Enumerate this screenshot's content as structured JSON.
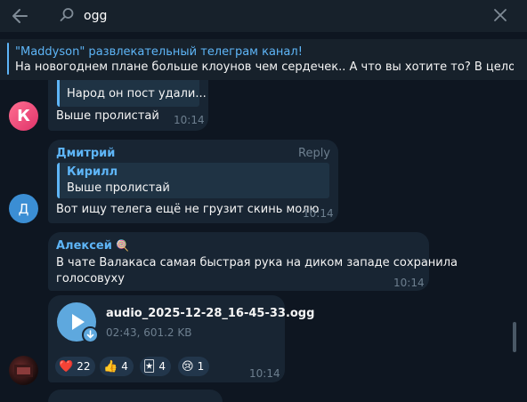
{
  "search": {
    "value": "ogg"
  },
  "pinned": {
    "title": "\"Maddyson\" развлекательный телеграм канал!",
    "text": "На новогоднем плане больше клоунов чем сердечек.. А что вы хотите то? В целом то, ч..."
  },
  "messages": [
    {
      "reply_text": "Народ он пост удали...",
      "text": "Выше пролистай",
      "time": "10:14",
      "avatar_letter": "К",
      "avatar_color": "#e6466f"
    },
    {
      "sender": "Дмитрий",
      "reply_label": "Reply",
      "reply_name": "Кирилл",
      "reply_text": "Выше пролистай",
      "text": "Вот ищу телега ещё не грузит скинь молю",
      "time": "10:14",
      "avatar_letter": "Д",
      "avatar_color": "#3b8ed4"
    },
    {
      "sender": "Алексей",
      "sender_emoji": "🍭",
      "text_line1": "В чате Валакаса самая быстрая рука на диком западе сохранила",
      "text_line2": "голосовуху",
      "time": "10:14"
    },
    {
      "file_name": "audio_2025-12-28_16-45-33.ogg",
      "file_meta": "02:43, 601.2 KB",
      "time": "10:14",
      "reactions": [
        {
          "emoji": "❤️",
          "count": "22"
        },
        {
          "emoji": "👍",
          "count": "4"
        },
        {
          "emoji": "🃏",
          "count": "4"
        },
        {
          "emoji": "😢",
          "count": "1"
        }
      ]
    }
  ],
  "colors": {
    "background": "#0e1621",
    "bubble": "#182533",
    "accent": "#5eb5f7",
    "muted": "#6d7f8f"
  }
}
